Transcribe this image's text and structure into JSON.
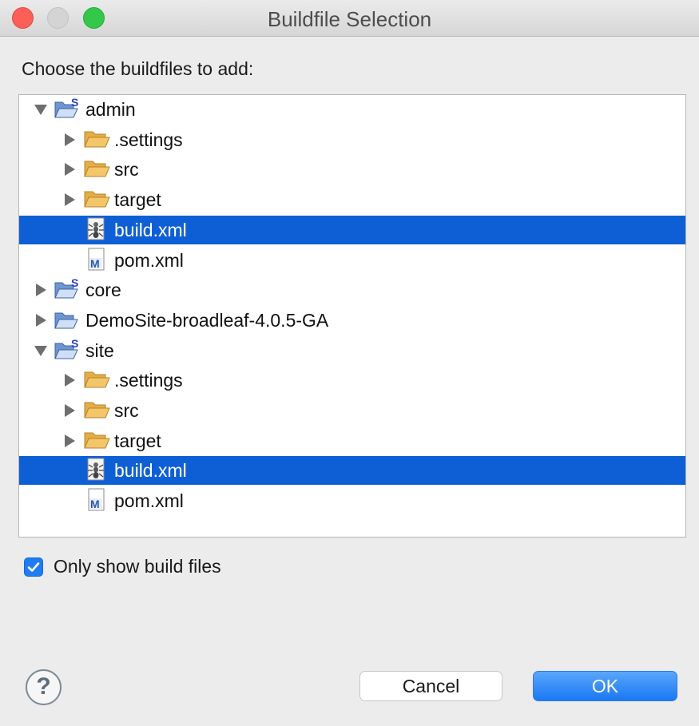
{
  "window": {
    "title": "Buildfile Selection"
  },
  "prompt": "Choose the buildfiles to add:",
  "tree": {
    "rows": [
      {
        "label": "admin",
        "level": 0,
        "expander": "expanded",
        "icon": "spring-project-icon",
        "selected": false
      },
      {
        "label": ".settings",
        "level": 1,
        "expander": "collapsed",
        "icon": "folder-icon",
        "selected": false
      },
      {
        "label": "src",
        "level": 1,
        "expander": "collapsed",
        "icon": "folder-icon",
        "selected": false
      },
      {
        "label": "target",
        "level": 1,
        "expander": "collapsed",
        "icon": "folder-icon",
        "selected": false
      },
      {
        "label": "build.xml",
        "level": 1,
        "expander": "none",
        "icon": "ant-buildfile-icon",
        "selected": true
      },
      {
        "label": "pom.xml",
        "level": 1,
        "expander": "none",
        "icon": "maven-pom-icon",
        "selected": false
      },
      {
        "label": "core",
        "level": 0,
        "expander": "collapsed",
        "icon": "spring-project-icon",
        "selected": false
      },
      {
        "label": "DemoSite-broadleaf-4.0.5-GA",
        "level": 0,
        "expander": "collapsed",
        "icon": "project-folder-icon",
        "selected": false
      },
      {
        "label": "site",
        "level": 0,
        "expander": "expanded",
        "icon": "spring-project-icon",
        "selected": false
      },
      {
        "label": ".settings",
        "level": 1,
        "expander": "collapsed",
        "icon": "folder-icon",
        "selected": false
      },
      {
        "label": "src",
        "level": 1,
        "expander": "collapsed",
        "icon": "folder-icon",
        "selected": false
      },
      {
        "label": "target",
        "level": 1,
        "expander": "collapsed",
        "icon": "folder-icon",
        "selected": false
      },
      {
        "label": "build.xml",
        "level": 1,
        "expander": "none",
        "icon": "ant-buildfile-icon",
        "selected": true
      },
      {
        "label": "pom.xml",
        "level": 1,
        "expander": "none",
        "icon": "maven-pom-icon",
        "selected": false
      }
    ]
  },
  "filter": {
    "label": "Only show build files",
    "checked": true
  },
  "buttons": {
    "help_glyph": "?",
    "cancel_label": "Cancel",
    "ok_label": "OK"
  },
  "colors": {
    "selection": "#0e5fd6",
    "accent": "#1f7cf2",
    "folder": "#f3c66a"
  }
}
